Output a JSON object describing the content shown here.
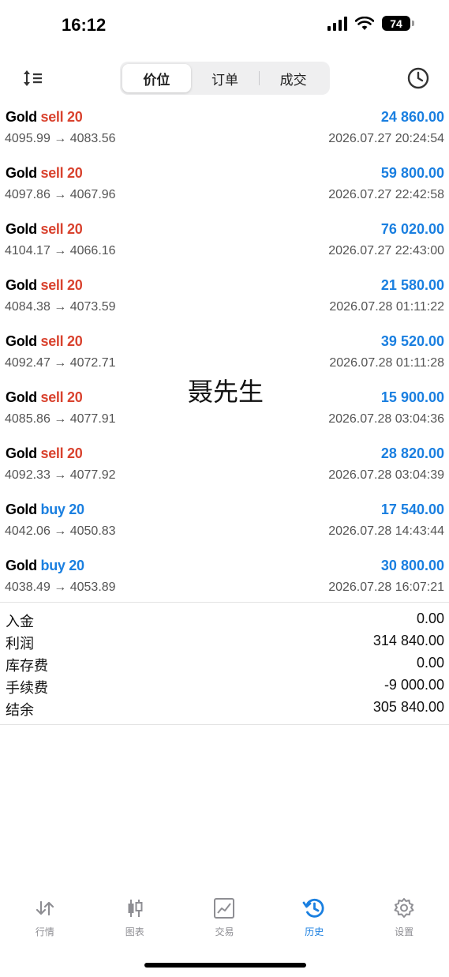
{
  "status": {
    "time": "16:12",
    "battery": "74"
  },
  "toolbar": {
    "segments": [
      "价位",
      "订单",
      "成交"
    ],
    "active_segment": 0
  },
  "trades": [
    {
      "symbol": "Gold",
      "side": "sell 20",
      "type": "sell",
      "profit": "24 860.00",
      "prices": "4095.99 → 4083.56",
      "datetime": "2026.07.27 20:24:54"
    },
    {
      "symbol": "Gold",
      "side": "sell 20",
      "type": "sell",
      "profit": "59 800.00",
      "prices": "4097.86 → 4067.96",
      "datetime": "2026.07.27 22:42:58"
    },
    {
      "symbol": "Gold",
      "side": "sell 20",
      "type": "sell",
      "profit": "76 020.00",
      "prices": "4104.17 → 4066.16",
      "datetime": "2026.07.27 22:43:00"
    },
    {
      "symbol": "Gold",
      "side": "sell 20",
      "type": "sell",
      "profit": "21 580.00",
      "prices": "4084.38 → 4073.59",
      "datetime": "2026.07.28 01:11:22"
    },
    {
      "symbol": "Gold",
      "side": "sell 20",
      "type": "sell",
      "profit": "39 520.00",
      "prices": "4092.47 → 4072.71",
      "datetime": "2026.07.28 01:11:28"
    },
    {
      "symbol": "Gold",
      "side": "sell 20",
      "type": "sell",
      "profit": "15 900.00",
      "prices": "4085.86 → 4077.91",
      "datetime": "2026.07.28 03:04:36"
    },
    {
      "symbol": "Gold",
      "side": "sell 20",
      "type": "sell",
      "profit": "28 820.00",
      "prices": "4092.33 → 4077.92",
      "datetime": "2026.07.28 03:04:39"
    },
    {
      "symbol": "Gold",
      "side": "buy 20",
      "type": "buy",
      "profit": "17 540.00",
      "prices": "4042.06 → 4050.83",
      "datetime": "2026.07.28 14:43:44"
    },
    {
      "symbol": "Gold",
      "side": "buy 20",
      "type": "buy",
      "profit": "30 800.00",
      "prices": "4038.49 → 4053.89",
      "datetime": "2026.07.28 16:07:21"
    }
  ],
  "watermark": "聂先生",
  "summary": [
    {
      "label": "入金",
      "value": "0.00"
    },
    {
      "label": "利润",
      "value": "314 840.00"
    },
    {
      "label": "库存费",
      "value": "0.00"
    },
    {
      "label": "手续费",
      "value": "-9 000.00"
    },
    {
      "label": "结余",
      "value": "305 840.00"
    }
  ],
  "tabs": [
    {
      "label": "行情",
      "icon": "quotes-arrows-icon"
    },
    {
      "label": "图表",
      "icon": "chart-candles-icon"
    },
    {
      "label": "交易",
      "icon": "trade-chart-icon"
    },
    {
      "label": "历史",
      "icon": "history-clock-icon"
    },
    {
      "label": "设置",
      "icon": "settings-gear-icon"
    }
  ],
  "active_tab": 3,
  "colors": {
    "accent": "#1a7fe0",
    "sell": "#d9432f",
    "buy": "#1a7fe0"
  }
}
